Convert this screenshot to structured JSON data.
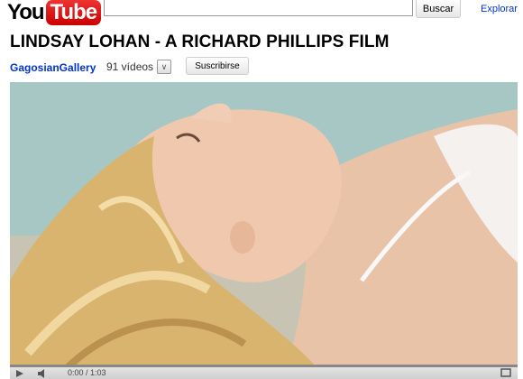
{
  "header": {
    "logo_you": "You",
    "logo_tube": "Tube",
    "search": {
      "value": "",
      "placeholder": ""
    },
    "search_button": "Buscar",
    "explore_link": "Explorar"
  },
  "video": {
    "title": "LINDSAY LOHAN - A RICHARD PHILLIPS FILM",
    "channel": "GagosianGallery",
    "video_count": "91 vídeos",
    "subscribe": "Suscribirse",
    "player": {
      "time": "0:00 / 1:03",
      "progress": 0.0
    }
  },
  "colors": {
    "link": "#0033cc",
    "logo_red": "#cc0000",
    "progress_red": "#dd0000"
  }
}
